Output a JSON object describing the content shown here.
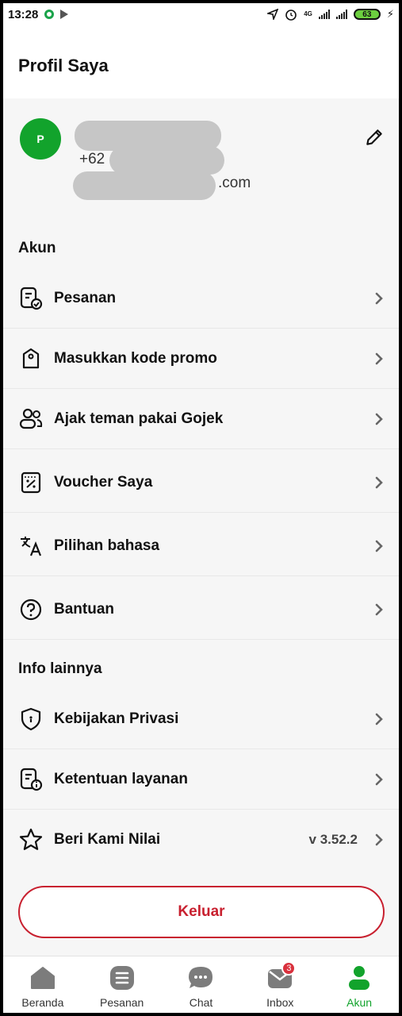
{
  "status_bar": {
    "time": "13:28",
    "network": "4G",
    "battery": "63"
  },
  "header": {
    "title": "Profil Saya"
  },
  "profile": {
    "avatar_initial": "P",
    "phone_prefix": "+62",
    "email_suffix": ".com"
  },
  "sections": {
    "account_title": "Akun",
    "other_title": "Info lainnya"
  },
  "account_items": [
    {
      "label": "Pesanan",
      "icon": "orders-icon"
    },
    {
      "label": "Masukkan kode promo",
      "icon": "promo-tag-icon"
    },
    {
      "label": "Ajak teman pakai Gojek",
      "icon": "invite-friends-icon"
    },
    {
      "label": "Voucher Saya",
      "icon": "voucher-icon"
    },
    {
      "label": "Pilihan bahasa",
      "icon": "language-icon"
    },
    {
      "label": "Bantuan",
      "icon": "help-icon"
    }
  ],
  "other_items": [
    {
      "label": "Kebijakan Privasi",
      "icon": "shield-icon"
    },
    {
      "label": "Ketentuan layanan",
      "icon": "terms-icon"
    },
    {
      "label": "Beri Kami Nilai",
      "icon": "star-icon",
      "version": "v 3.52.2"
    }
  ],
  "logout": {
    "label": "Keluar"
  },
  "bottom_nav": [
    {
      "label": "Beranda",
      "icon": "home-icon"
    },
    {
      "label": "Pesanan",
      "icon": "orders-nav-icon"
    },
    {
      "label": "Chat",
      "icon": "chat-icon"
    },
    {
      "label": "Inbox",
      "icon": "inbox-icon",
      "badge": "3"
    },
    {
      "label": "Akun",
      "icon": "account-icon",
      "active": true
    }
  ],
  "colors": {
    "brand_green": "#12a32c",
    "logout_red": "#c8202f",
    "badge_red": "#d9313d"
  }
}
